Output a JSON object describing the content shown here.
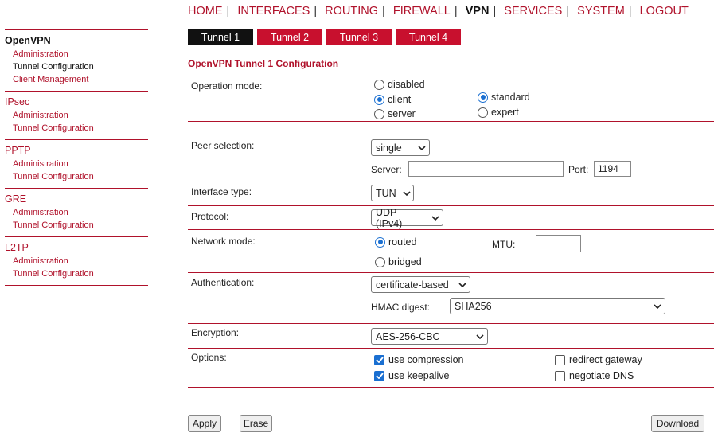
{
  "topnav": [
    {
      "label": "HOME",
      "active": false
    },
    {
      "label": "INTERFACES",
      "active": false
    },
    {
      "label": "ROUTING",
      "active": false
    },
    {
      "label": "FIREWALL",
      "active": false
    },
    {
      "label": "VPN",
      "active": true
    },
    {
      "label": "SERVICES",
      "active": false
    },
    {
      "label": "SYSTEM",
      "active": false
    },
    {
      "label": "LOGOUT",
      "active": false
    }
  ],
  "sidebar": {
    "openvpn": {
      "title": "OpenVPN",
      "items": [
        "Administration",
        "Tunnel Configuration",
        "Client Management"
      ]
    },
    "ipsec": {
      "title": "IPsec",
      "items": [
        "Administration",
        "Tunnel Configuration"
      ]
    },
    "pptp": {
      "title": "PPTP",
      "items": [
        "Administration",
        "Tunnel Configuration"
      ]
    },
    "gre": {
      "title": "GRE",
      "items": [
        "Administration",
        "Tunnel Configuration"
      ]
    },
    "l2tp": {
      "title": "L2TP",
      "items": [
        "Administration",
        "Tunnel Configuration"
      ]
    }
  },
  "tabs": [
    "Tunnel 1",
    "Tunnel 2",
    "Tunnel 3",
    "Tunnel 4"
  ],
  "section_title": "OpenVPN Tunnel 1 Configuration",
  "form": {
    "operation_mode": {
      "label": "Operation mode:",
      "options": [
        "disabled",
        "client",
        "server"
      ],
      "selected": "client",
      "style_options": [
        "standard",
        "expert"
      ],
      "style_selected": "standard"
    },
    "peer_selection": {
      "label": "Peer selection:",
      "value": "single",
      "server_label": "Server:",
      "server_value": "",
      "port_label": "Port:",
      "port_value": "1194"
    },
    "interface_type": {
      "label": "Interface type:",
      "value": "TUN"
    },
    "protocol": {
      "label": "Protocol:",
      "value": "UDP (IPv4)"
    },
    "network_mode": {
      "label": "Network mode:",
      "options": [
        "routed",
        "bridged"
      ],
      "selected": "routed",
      "mtu_label": "MTU:",
      "mtu_value": ""
    },
    "authentication": {
      "label": "Authentication:",
      "value": "certificate-based",
      "hmac_label": "HMAC digest:",
      "hmac_value": "SHA256"
    },
    "encryption": {
      "label": "Encryption:",
      "value": "AES-256-CBC"
    },
    "options": {
      "label": "Options:",
      "use_compression": {
        "label": "use compression",
        "checked": true
      },
      "use_keepalive": {
        "label": "use keepalive",
        "checked": true
      },
      "redirect_gateway": {
        "label": "redirect gateway",
        "checked": false
      },
      "negotiate_dns": {
        "label": "negotiate DNS",
        "checked": false
      }
    }
  },
  "buttons": {
    "apply": "Apply",
    "erase": "Erase",
    "download": "Download"
  },
  "colors": {
    "accent": "#b0122b",
    "tab": "#c8102e",
    "tab_active": "#111111",
    "control_blue": "#1a6fd1"
  }
}
